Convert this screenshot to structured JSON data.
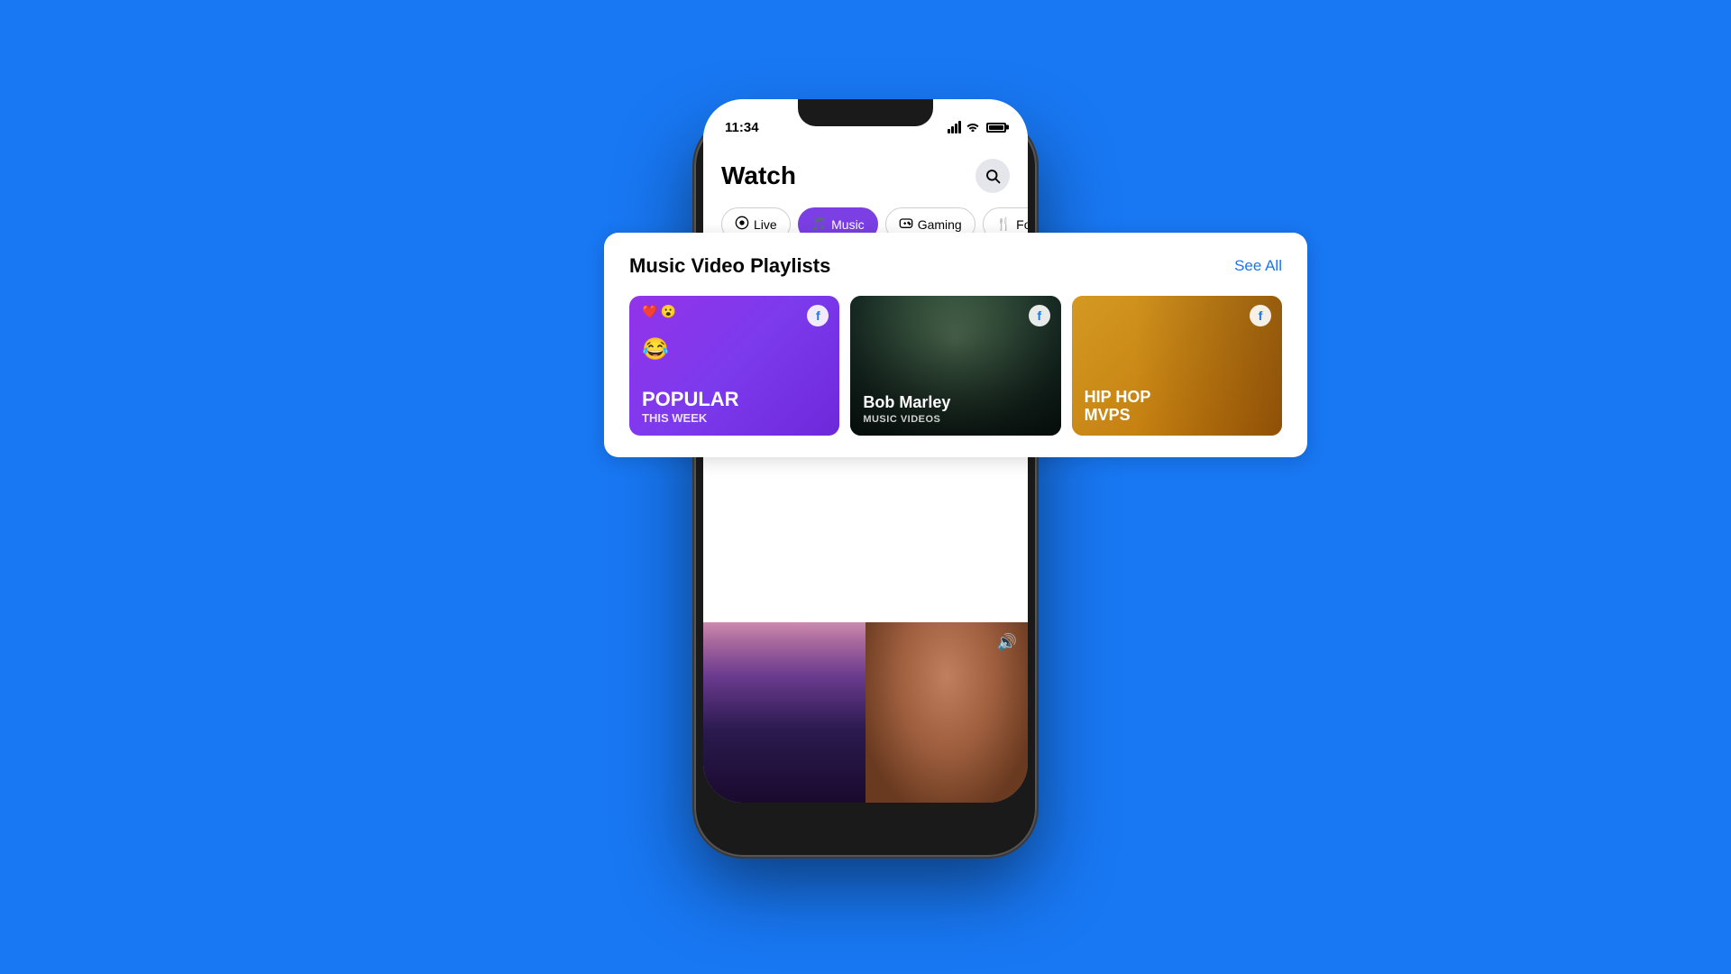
{
  "background_color": "#1877F2",
  "status_bar": {
    "time": "11:34"
  },
  "watch_page": {
    "title": "Watch",
    "search_label": "Search",
    "tabs": [
      {
        "id": "live",
        "label": "Live",
        "icon": "🎥",
        "active": false
      },
      {
        "id": "music",
        "label": "Music",
        "icon": "🎵",
        "active": true
      },
      {
        "id": "gaming",
        "label": "Gaming",
        "icon": "🎮",
        "active": false
      },
      {
        "id": "food",
        "label": "Food",
        "icon": "🍴",
        "active": false
      }
    ]
  },
  "playlist_card": {
    "title": "Music Video Playlists",
    "see_all_label": "See All",
    "playlists": [
      {
        "id": "popular",
        "title": "POPULAR",
        "subtitle": "THIS WEEK",
        "type": "popular",
        "emoji_top": "❤️ 😮",
        "emoji_big": "😂"
      },
      {
        "id": "bob-marley",
        "title": "Bob Marley",
        "subtitle": "MUSIC VIDEOS",
        "type": "bob-marley"
      },
      {
        "id": "hiphop",
        "title": "HIP HOP",
        "subtitle": "MVPs",
        "type": "hiphop"
      }
    ]
  },
  "bottom_video": {
    "volume_icon": "🔊"
  }
}
